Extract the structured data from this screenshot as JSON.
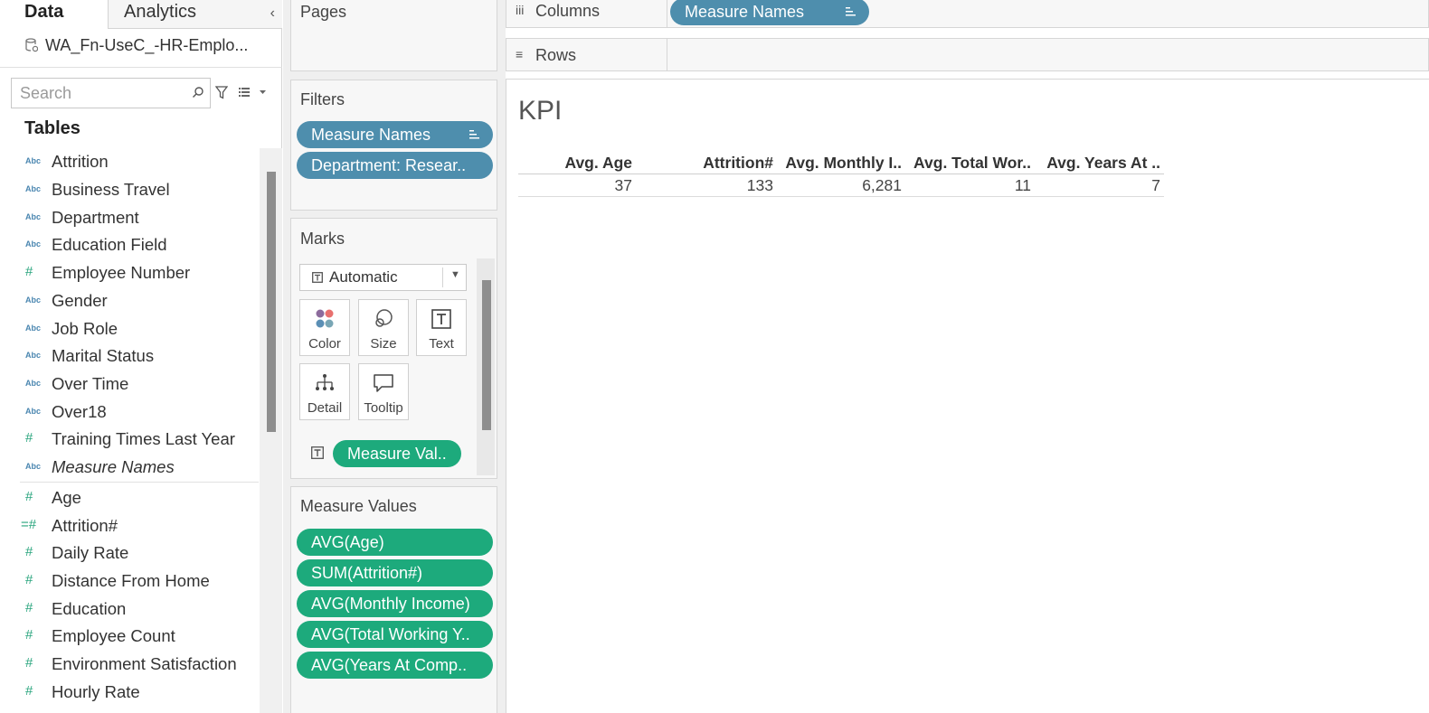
{
  "left_pane": {
    "tabs": {
      "data": "Data",
      "analytics": "Analytics"
    },
    "collapse_glyph": "‹",
    "datasource": "WA_Fn-UseC_-HR-Emplo...",
    "search_placeholder": "Search",
    "tables_heading": "Tables",
    "dimensions": [
      {
        "type": "Abc",
        "name": "Attrition"
      },
      {
        "type": "Abc",
        "name": "Business Travel"
      },
      {
        "type": "Abc",
        "name": "Department"
      },
      {
        "type": "Abc",
        "name": "Education Field"
      },
      {
        "type": "#",
        "name": "Employee Number"
      },
      {
        "type": "Abc",
        "name": "Gender"
      },
      {
        "type": "Abc",
        "name": "Job Role"
      },
      {
        "type": "Abc",
        "name": "Marital Status"
      },
      {
        "type": "Abc",
        "name": "Over Time"
      },
      {
        "type": "Abc",
        "name": "Over18"
      },
      {
        "type": "#",
        "name": "Training Times Last Year"
      },
      {
        "type": "Abc",
        "name": "Measure Names"
      }
    ],
    "measures": [
      {
        "type": "#",
        "name": "Age"
      },
      {
        "type": "=#",
        "name": "Attrition#"
      },
      {
        "type": "#",
        "name": "Daily Rate"
      },
      {
        "type": "#",
        "name": "Distance From Home"
      },
      {
        "type": "#",
        "name": "Education"
      },
      {
        "type": "#",
        "name": "Employee Count"
      },
      {
        "type": "#",
        "name": "Environment Satisfaction"
      },
      {
        "type": "#",
        "name": "Hourly Rate"
      }
    ]
  },
  "cards": {
    "pages": {
      "title": "Pages"
    },
    "filters": {
      "title": "Filters",
      "pills": [
        "Measure Names",
        "Department: Resear.."
      ]
    },
    "marks": {
      "title": "Marks",
      "mark_type": "Automatic",
      "buttons": {
        "color": "Color",
        "size": "Size",
        "text": "Text",
        "detail": "Detail",
        "tooltip": "Tooltip"
      },
      "text_pill": "Measure Val.."
    },
    "measure_values": {
      "title": "Measure Values",
      "pills": [
        "AVG(Age)",
        "SUM(Attrition#)",
        "AVG(Monthly Income)",
        "AVG(Total Working Y..",
        "AVG(Years At Comp.."
      ]
    }
  },
  "shelves": {
    "columns": {
      "label": "Columns",
      "icon": "iii",
      "pill": "Measure Names"
    },
    "rows": {
      "label": "Rows",
      "icon": "≡"
    }
  },
  "viz": {
    "title": "KPI",
    "headers": [
      "Avg. Age",
      "Attrition#",
      "Avg. Monthly I..",
      "Avg. Total Wor..",
      "Avg. Years At .."
    ],
    "values": [
      "37",
      "133",
      "6,281",
      "11",
      "7"
    ]
  },
  "colors": {
    "dimension_pill": "#4e8ead",
    "measure_pill": "#1daa7c",
    "mark_color_dots": [
      "#8c6b9c",
      "#e8706e",
      "#5b8fb5",
      "#79a6b5"
    ]
  }
}
